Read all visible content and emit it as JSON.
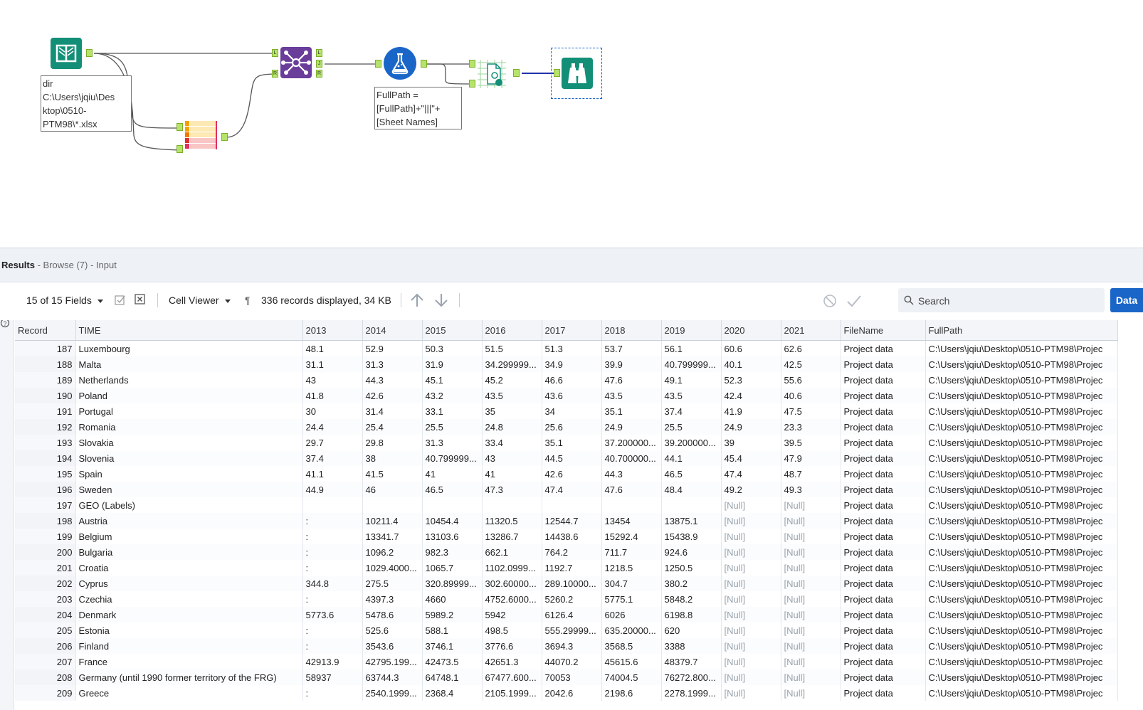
{
  "canvas": {
    "annotations": {
      "input": "dir\nC:\\Users\\jqiu\\Des\nktop\\0510-\nPTM98\\*.xlsx",
      "formula": "FullPath =\n[FullPath]+\"|||\"+\n[Sheet Names]"
    },
    "anchors": {
      "left": "L",
      "join": "J",
      "right": "R"
    }
  },
  "results": {
    "title": "Results",
    "subtitle": " - Browse (7) - Input"
  },
  "toolbar": {
    "fields_label": "15 of 15 Fields",
    "viewer_label": "Cell Viewer",
    "records_label": "336 records displayed, 34 KB",
    "search_placeholder": "Search",
    "data_button": "Data"
  },
  "grid": {
    "columns": [
      "Record",
      "TIME",
      "2013",
      "2014",
      "2015",
      "2016",
      "2017",
      "2018",
      "2019",
      "2020",
      "2021",
      "FileName",
      "FullPath"
    ],
    "rows": [
      [
        "187",
        "Luxembourg",
        "48.1",
        "52.9",
        "50.3",
        "51.5",
        "51.3",
        "53.7",
        "56.1",
        "60.6",
        "62.6",
        "Project data",
        "C:\\Users\\jqiu\\Desktop\\0510-PTM98\\Projec"
      ],
      [
        "188",
        "Malta",
        "31.1",
        "31.3",
        "31.9",
        "34.299999...",
        "34.9",
        "39.9",
        "40.799999...",
        "40.1",
        "42.5",
        "Project data",
        "C:\\Users\\jqiu\\Desktop\\0510-PTM98\\Projec"
      ],
      [
        "189",
        "Netherlands",
        "43",
        "44.3",
        "45.1",
        "45.2",
        "46.6",
        "47.6",
        "49.1",
        "52.3",
        "55.6",
        "Project data",
        "C:\\Users\\jqiu\\Desktop\\0510-PTM98\\Projec"
      ],
      [
        "190",
        "Poland",
        "41.8",
        "42.6",
        "43.2",
        "43.5",
        "43.6",
        "43.5",
        "43.5",
        "42.4",
        "40.6",
        "Project data",
        "C:\\Users\\jqiu\\Desktop\\0510-PTM98\\Projec"
      ],
      [
        "191",
        "Portugal",
        "30",
        "31.4",
        "33.1",
        "35",
        "34",
        "35.1",
        "37.4",
        "41.9",
        "47.5",
        "Project data",
        "C:\\Users\\jqiu\\Desktop\\0510-PTM98\\Projec"
      ],
      [
        "192",
        "Romania",
        "24.4",
        "25.4",
        "25.5",
        "24.8",
        "25.6",
        "24.9",
        "25.5",
        "24.9",
        "23.3",
        "Project data",
        "C:\\Users\\jqiu\\Desktop\\0510-PTM98\\Projec"
      ],
      [
        "193",
        "Slovakia",
        "29.7",
        "29.8",
        "31.3",
        "33.4",
        "35.1",
        "37.200000...",
        "39.200000...",
        "39",
        "39.5",
        "Project data",
        "C:\\Users\\jqiu\\Desktop\\0510-PTM98\\Projec"
      ],
      [
        "194",
        "Slovenia",
        "37.4",
        "38",
        "40.799999...",
        "43",
        "44.5",
        "40.700000...",
        "44.1",
        "45.4",
        "47.9",
        "Project data",
        "C:\\Users\\jqiu\\Desktop\\0510-PTM98\\Projec"
      ],
      [
        "195",
        "Spain",
        "41.1",
        "41.5",
        "41",
        "41",
        "42.6",
        "44.3",
        "46.5",
        "47.4",
        "48.7",
        "Project data",
        "C:\\Users\\jqiu\\Desktop\\0510-PTM98\\Projec"
      ],
      [
        "196",
        "Sweden",
        "44.9",
        "46",
        "46.5",
        "47.3",
        "47.4",
        "47.6",
        "48.4",
        "49.2",
        "49.3",
        "Project data",
        "C:\\Users\\jqiu\\Desktop\\0510-PTM98\\Projec"
      ],
      [
        "197",
        "GEO (Labels)",
        "",
        "",
        "",
        "",
        "",
        "",
        "",
        "[Null]",
        "[Null]",
        "Project data",
        "C:\\Users\\jqiu\\Desktop\\0510-PTM98\\Projec"
      ],
      [
        "198",
        "Austria",
        ":",
        "10211.4",
        "10454.4",
        "11320.5",
        "12544.7",
        "13454",
        "13875.1",
        "[Null]",
        "[Null]",
        "Project data",
        "C:\\Users\\jqiu\\Desktop\\0510-PTM98\\Projec"
      ],
      [
        "199",
        "Belgium",
        ":",
        "13341.7",
        "13103.6",
        "13286.7",
        "14438.6",
        "15292.4",
        "15438.9",
        "[Null]",
        "[Null]",
        "Project data",
        "C:\\Users\\jqiu\\Desktop\\0510-PTM98\\Projec"
      ],
      [
        "200",
        "Bulgaria",
        ":",
        "1096.2",
        "982.3",
        "662.1",
        "764.2",
        "711.7",
        "924.6",
        "[Null]",
        "[Null]",
        "Project data",
        "C:\\Users\\jqiu\\Desktop\\0510-PTM98\\Projec"
      ],
      [
        "201",
        "Croatia",
        ":",
        "1029.4000...",
        "1065.7",
        "1102.0999...",
        "1192.7",
        "1218.5",
        "1250.5",
        "[Null]",
        "[Null]",
        "Project data",
        "C:\\Users\\jqiu\\Desktop\\0510-PTM98\\Projec"
      ],
      [
        "202",
        "Cyprus",
        "344.8",
        "275.5",
        "320.89999...",
        "302.60000...",
        "289.10000...",
        "304.7",
        "380.2",
        "[Null]",
        "[Null]",
        "Project data",
        "C:\\Users\\jqiu\\Desktop\\0510-PTM98\\Projec"
      ],
      [
        "203",
        "Czechia",
        ":",
        "4397.3",
        "4660",
        "4752.6000...",
        "5260.2",
        "5775.1",
        "5848.2",
        "[Null]",
        "[Null]",
        "Project data",
        "C:\\Users\\jqiu\\Desktop\\0510-PTM98\\Projec"
      ],
      [
        "204",
        "Denmark",
        "5773.6",
        "5478.6",
        "5989.2",
        "5942",
        "6126.4",
        "6026",
        "6198.8",
        "[Null]",
        "[Null]",
        "Project data",
        "C:\\Users\\jqiu\\Desktop\\0510-PTM98\\Projec"
      ],
      [
        "205",
        "Estonia",
        ":",
        "525.6",
        "588.1",
        "498.5",
        "555.29999...",
        "635.20000...",
        "620",
        "[Null]",
        "[Null]",
        "Project data",
        "C:\\Users\\jqiu\\Desktop\\0510-PTM98\\Projec"
      ],
      [
        "206",
        "Finland",
        ":",
        "3543.6",
        "3746.1",
        "3776.6",
        "3694.3",
        "3568.5",
        "3388",
        "[Null]",
        "[Null]",
        "Project data",
        "C:\\Users\\jqiu\\Desktop\\0510-PTM98\\Projec"
      ],
      [
        "207",
        "France",
        "42913.9",
        "42795.199...",
        "42473.5",
        "42651.3",
        "44070.2",
        "45615.6",
        "48379.7",
        "[Null]",
        "[Null]",
        "Project data",
        "C:\\Users\\jqiu\\Desktop\\0510-PTM98\\Projec"
      ],
      [
        "208",
        "Germany (until 1990 former territory of the FRG)",
        "58937",
        "63744.3",
        "64748.1",
        "67477.600...",
        "70053",
        "74004.5",
        "76272.800...",
        "[Null]",
        "[Null]",
        "Project data",
        "C:\\Users\\jqiu\\Desktop\\0510-PTM98\\Projec"
      ],
      [
        "209",
        "Greece",
        ":",
        "2540.1999...",
        "2368.4",
        "2105.1999...",
        "2042.6",
        "2198.6",
        "2278.1999...",
        "[Null]",
        "[Null]",
        "Project data",
        "C:\\Users\\jqiu\\Desktop\\0510-PTM98\\Projec"
      ]
    ]
  },
  "colors": {
    "teal": "#138f78",
    "purple": "#6a3d9a",
    "blue": "#1a66c8",
    "anchor_green": "#b6e36a"
  }
}
